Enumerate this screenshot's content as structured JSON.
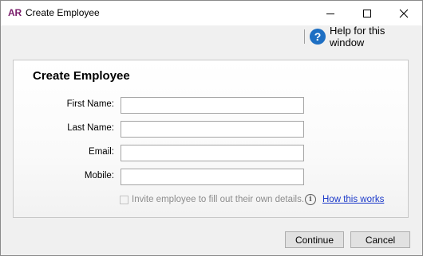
{
  "window": {
    "app_logo": "AR",
    "title": "Create Employee",
    "controls": {
      "minimize": "minimize-icon",
      "maximize": "maximize-icon",
      "close": "close-icon"
    }
  },
  "toolbar": {
    "help_icon": "?",
    "help_label": "Help for this window"
  },
  "form": {
    "heading": "Create Employee",
    "fields": [
      {
        "label": "First Name:",
        "value": ""
      },
      {
        "label": "Last Name:",
        "value": ""
      },
      {
        "label": "Email:",
        "value": ""
      },
      {
        "label": "Mobile:",
        "value": ""
      }
    ],
    "invite": {
      "checked": false,
      "enabled": false,
      "label": "Invite employee to fill out their own details."
    },
    "info_icon": "i",
    "how_link": "How this works"
  },
  "buttons": {
    "continue_label": "Continue",
    "cancel_label": "Cancel"
  },
  "colors": {
    "app_logo": "#7a1f6b",
    "help_icon_bg": "#1e6fc3",
    "link": "#1a38c9",
    "disabled_text": "#8c8c8c"
  }
}
